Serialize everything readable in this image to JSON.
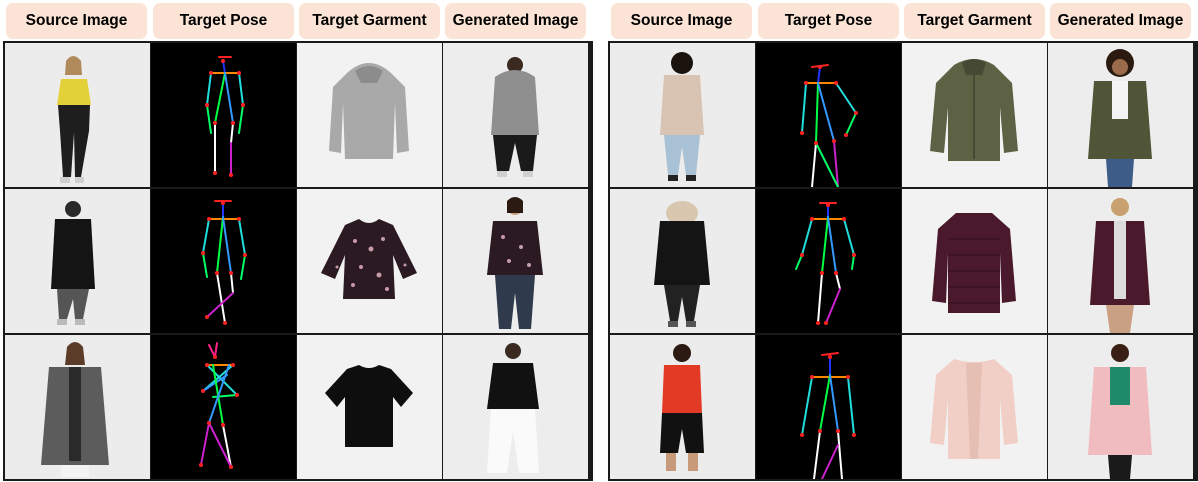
{
  "headers": [
    "Source Image",
    "Target Pose",
    "Target Garment",
    "Generated Image"
  ],
  "colors": {
    "header_bg": "#fbe4d5",
    "grid_border": "#1a1a1a",
    "photo_bg": "#f1f1f1",
    "pose_bg": "#000000"
  },
  "panels": [
    {
      "id": "left",
      "rows": [
        {
          "source": "woman in yellow floral top and black leather trousers",
          "garment": "grey hooded wool coat",
          "generated": "woman from behind wearing grey hooded coat"
        },
        {
          "source": "woman from behind in black belted coat",
          "garment": "black floral print blouse",
          "generated": "woman wearing black floral blouse and jeans"
        },
        {
          "source": "woman in grey tweed long coat",
          "garment": "black short-sleeve top",
          "generated": "woman from behind in black top and white trousers"
        }
      ]
    },
    {
      "id": "right",
      "rows": [
        {
          "source": "woman from behind in beige coat and jeans",
          "garment": "olive green parka",
          "generated": "woman wearing olive green parka"
        },
        {
          "source": "woman from behind in black parka with fur hood",
          "garment": "burgundy quilted puffer coat",
          "generated": "woman wearing burgundy puffer coat"
        },
        {
          "source": "woman from behind in red sleeveless top",
          "garment": "light pink collarless coat",
          "generated": "woman wearing pink coat over green top"
        }
      ]
    }
  ]
}
